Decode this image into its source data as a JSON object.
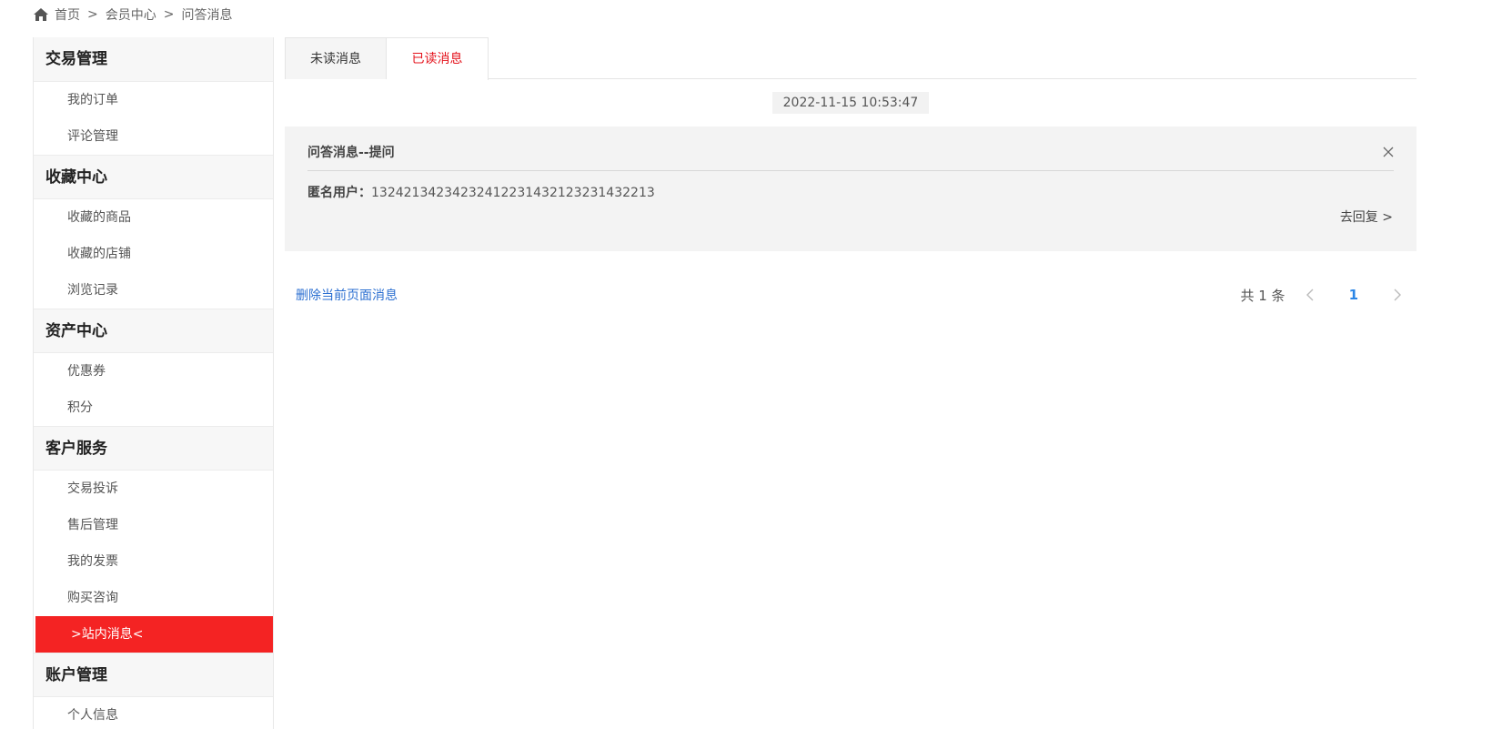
{
  "breadcrumb": {
    "home": "首页",
    "separator": ">",
    "member_center": "会员中心",
    "current": "问答消息"
  },
  "sidebar": {
    "groups": [
      {
        "title": "交易管理",
        "items": [
          "我的订单",
          "评论管理"
        ]
      },
      {
        "title": "收藏中心",
        "items": [
          "收藏的商品",
          "收藏的店铺",
          "浏览记录"
        ]
      },
      {
        "title": "资产中心",
        "items": [
          "优惠券",
          "积分"
        ]
      },
      {
        "title": "客户服务",
        "items": [
          "交易投诉",
          "售后管理",
          "我的发票",
          "购买咨询",
          ">站内消息<"
        ]
      },
      {
        "title": "账户管理",
        "items": [
          "个人信息"
        ]
      }
    ],
    "active_item": ">站内消息<"
  },
  "tabs": [
    {
      "label": "未读消息"
    },
    {
      "label": "已读消息"
    }
  ],
  "message": {
    "timestamp": "2022-11-15 10:53:47",
    "title": "问答消息--提问",
    "user_label": "匿名用户：",
    "user_content": "13242134234232412231432123231432213",
    "reply_label": "去回复 >"
  },
  "actions": {
    "delete_label": "删除当前页面消息"
  },
  "pagination": {
    "total": "共 1 条",
    "current_page": "1"
  },
  "colors": {
    "accent_red": "#f42323",
    "tab_selected_text": "#e4131c",
    "link_blue": "#2b6fd1",
    "page_blue": "#2b86e6"
  },
  "icons": [
    "home-icon",
    "close-icon",
    "chevron-left-icon",
    "chevron-right-icon"
  ]
}
